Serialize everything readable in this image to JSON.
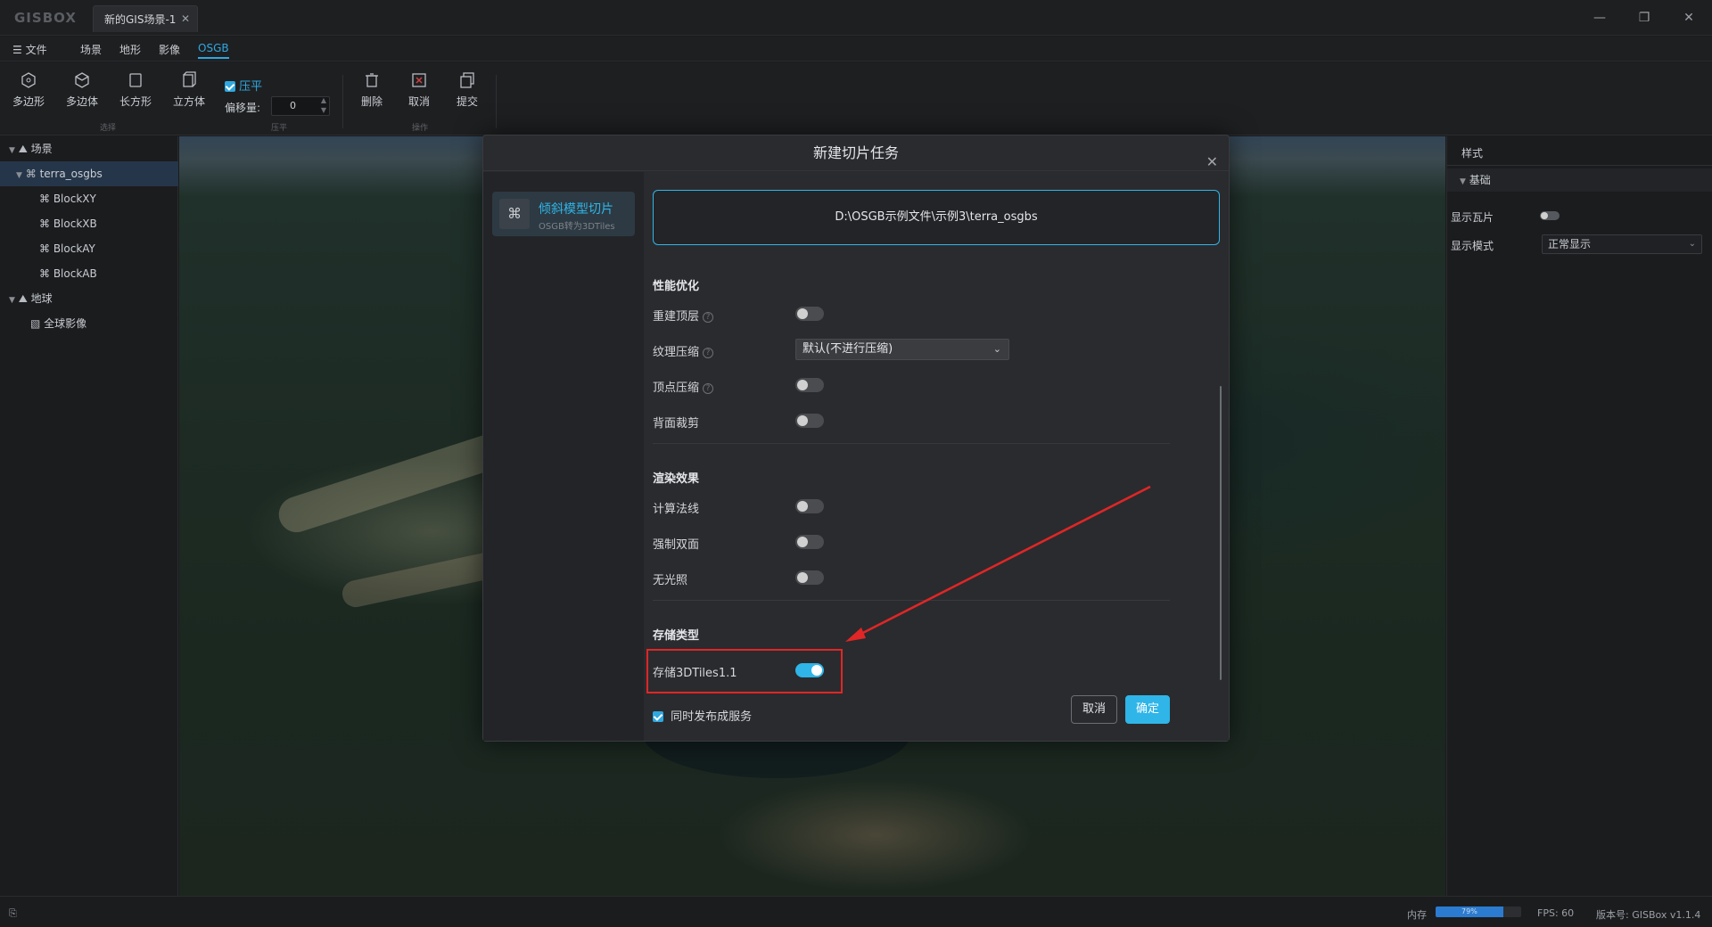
{
  "app": {
    "logo": "GISBOX",
    "doc_tab": "新的GIS场景-1"
  },
  "menu": [
    "文件",
    "场景",
    "地形",
    "影像",
    "OSGB"
  ],
  "toolbar": {
    "tools": [
      "多边形",
      "多边体",
      "长方形",
      "立方体"
    ],
    "flatten_label": "压平",
    "offset_label": "偏移量:",
    "offset_value": "0",
    "groups": [
      "选择",
      "压平",
      "操作"
    ],
    "ops": [
      "删除",
      "取消",
      "提交"
    ]
  },
  "tree": {
    "scene": "场景",
    "root": "terra_osgbs",
    "blocks": [
      "BlockXY",
      "BlockXB",
      "BlockAY",
      "BlockAB"
    ],
    "earth": "地球",
    "imagery": "全球影像"
  },
  "right_panel": {
    "tab": "样式",
    "section": "基础",
    "show_tiles_label": "显示瓦片",
    "display_mode_label": "显示模式",
    "display_mode_value": "正常显示"
  },
  "dialog": {
    "title": "新建切片任务",
    "nav": {
      "title": "倾斜模型切片",
      "subtitle": "OSGB转为3DTiles"
    },
    "path": "D:\\OSGB示例文件\\示例3\\terra_osgbs",
    "perf_title": "性能优化",
    "rebuild_top": "重建顶层",
    "texture_compress": "纹理压缩",
    "texture_value": "默认(不进行压缩)",
    "vertex_compress": "顶点压缩",
    "backface_cull": "背面裁剪",
    "render_title": "渲染效果",
    "calc_normals": "计算法线",
    "double_sided": "强制双面",
    "unlit": "无光照",
    "storage_title": "存储类型",
    "store_3dtiles11": "存储3DTiles1.1",
    "publish_label": "同时发布成服务",
    "cancel": "取消",
    "ok": "确定"
  },
  "status": {
    "mem_label": "内存",
    "mem_value": "79%",
    "mem_fraction": 0.79,
    "fps": "FPS: 60",
    "version": "版本号: GISBox v1.1.4"
  },
  "colors": {
    "accent": "#2fb5e8",
    "highlight": "#e02626"
  }
}
